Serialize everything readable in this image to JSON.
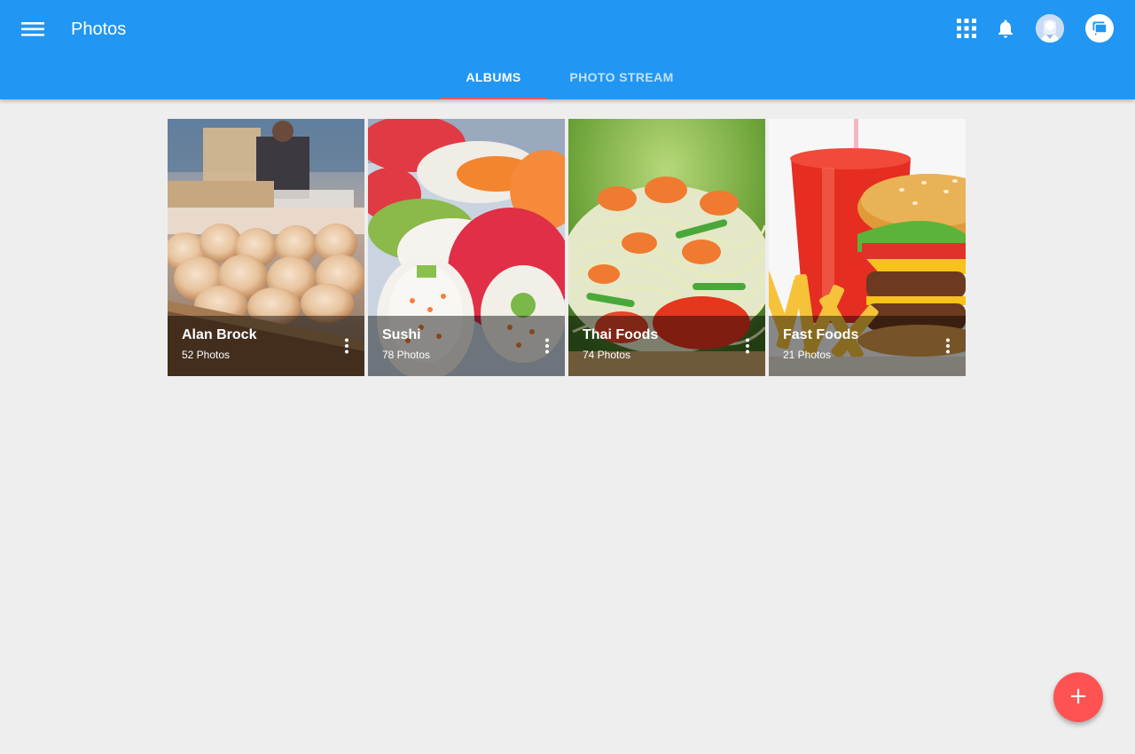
{
  "app": {
    "title": "Photos"
  },
  "tabs": [
    {
      "label": "ALBUMS",
      "active": true
    },
    {
      "label": "PHOTO STREAM",
      "active": false
    }
  ],
  "header_icons": [
    "menu-icon",
    "apps-grid-icon",
    "bell-icon",
    "avatar",
    "chat-icon"
  ],
  "albums": [
    {
      "name": "Alan Brock",
      "count": "52 Photos",
      "image": "donuts-market-photo"
    },
    {
      "name": "Sushi",
      "count": "78 Photos",
      "image": "sushi-rolls-photo"
    },
    {
      "name": "Thai Foods",
      "count": "74 Photos",
      "image": "papaya-salad-photo"
    },
    {
      "name": "Fast Foods",
      "count": "21 Photos",
      "image": "burger-fries-photo"
    }
  ],
  "fab": {
    "label": "+"
  },
  "colors": {
    "primary": "#2196f3",
    "accent": "#ff5252",
    "background": "#eeeeee"
  }
}
